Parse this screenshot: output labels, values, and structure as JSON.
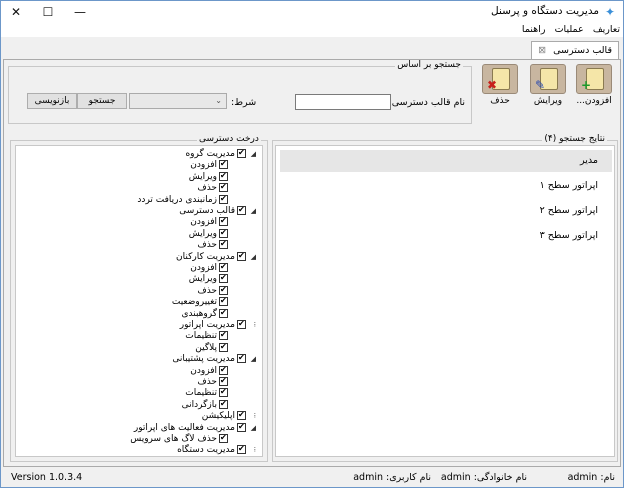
{
  "window": {
    "title": "مدیریت دستگاه و پرسنل",
    "app_icon": "app-logo-icon",
    "minimize_glyph": "—",
    "maximize_glyph": "☐",
    "close_glyph": "✕"
  },
  "menu": [
    "تعاریف",
    "عملیات",
    "راهنما"
  ],
  "tab": {
    "label": "قالب دسترسی",
    "close": "⊠"
  },
  "search": {
    "legend": "جستجو بر اساس",
    "template_name_label": "نام قالب دسترسی:",
    "template_name_value": "",
    "condition_label": "شرط:",
    "condition_value": "",
    "search_button": "جستجو",
    "reset_button": "بازنویسی"
  },
  "toolbar": {
    "add_label": "افزودن...",
    "edit_label": "ویرایش",
    "delete_label": "حذف"
  },
  "tree": {
    "legend": "درخت دسترسی",
    "items": [
      {
        "label": "مدیریت گروه",
        "level": 0,
        "expanded": true
      },
      {
        "label": "افزودن",
        "level": 1
      },
      {
        "label": "ویرایش",
        "level": 1
      },
      {
        "label": "حذف",
        "level": 1
      },
      {
        "label": "زمانبندی دریافت تردد",
        "level": 1
      },
      {
        "label": "قالب دسترسی",
        "level": 0,
        "expanded": true
      },
      {
        "label": "افزودن",
        "level": 1
      },
      {
        "label": "ویرایش",
        "level": 1
      },
      {
        "label": "حذف",
        "level": 1
      },
      {
        "label": "مدیریت کارکنان",
        "level": 0,
        "expanded": true
      },
      {
        "label": "افزودن",
        "level": 1
      },
      {
        "label": "ویرایش",
        "level": 1
      },
      {
        "label": "حذف",
        "level": 1
      },
      {
        "label": "تغییروضعیت",
        "level": 1
      },
      {
        "label": "گروهبندی",
        "level": 1
      },
      {
        "label": "مدیریت اپراتور",
        "level": 0,
        "expanded": false
      },
      {
        "label": "تنظیمات",
        "level": 1
      },
      {
        "label": "پلاگین",
        "level": 1
      },
      {
        "label": "مدیریت پشتیبانی",
        "level": 0,
        "expanded": true
      },
      {
        "label": "افزودن",
        "level": 1
      },
      {
        "label": "حذف",
        "level": 1
      },
      {
        "label": "تنظیمات",
        "level": 1
      },
      {
        "label": "بازگردانی",
        "level": 1
      },
      {
        "label": "اپلیکیشن",
        "level": 0,
        "expanded": false
      },
      {
        "label": "مدیریت فعالیت های اپراتور",
        "level": 0,
        "expanded": true
      },
      {
        "label": "حذف لاگ های سرویس",
        "level": 1
      },
      {
        "label": "مدیریت دستگاه",
        "level": 0,
        "expanded": false
      }
    ]
  },
  "results": {
    "legend": "نتایج جستجو (۴)",
    "items": [
      "مدیر",
      "اپراتور سطح ۱",
      "اپراتور سطح ۲",
      "اپراتور سطح ۳"
    ],
    "selected_index": 0
  },
  "status": {
    "version": "Version 1.0.3.4",
    "username_label": "نام کاربری:",
    "username": "admin",
    "family_label": "نام خانوادگی:",
    "family": "admin",
    "name_label": "نام:",
    "name": "admin"
  },
  "colors": {
    "selected_row": "#e6e6e6",
    "window_border": "#6c97c9"
  }
}
